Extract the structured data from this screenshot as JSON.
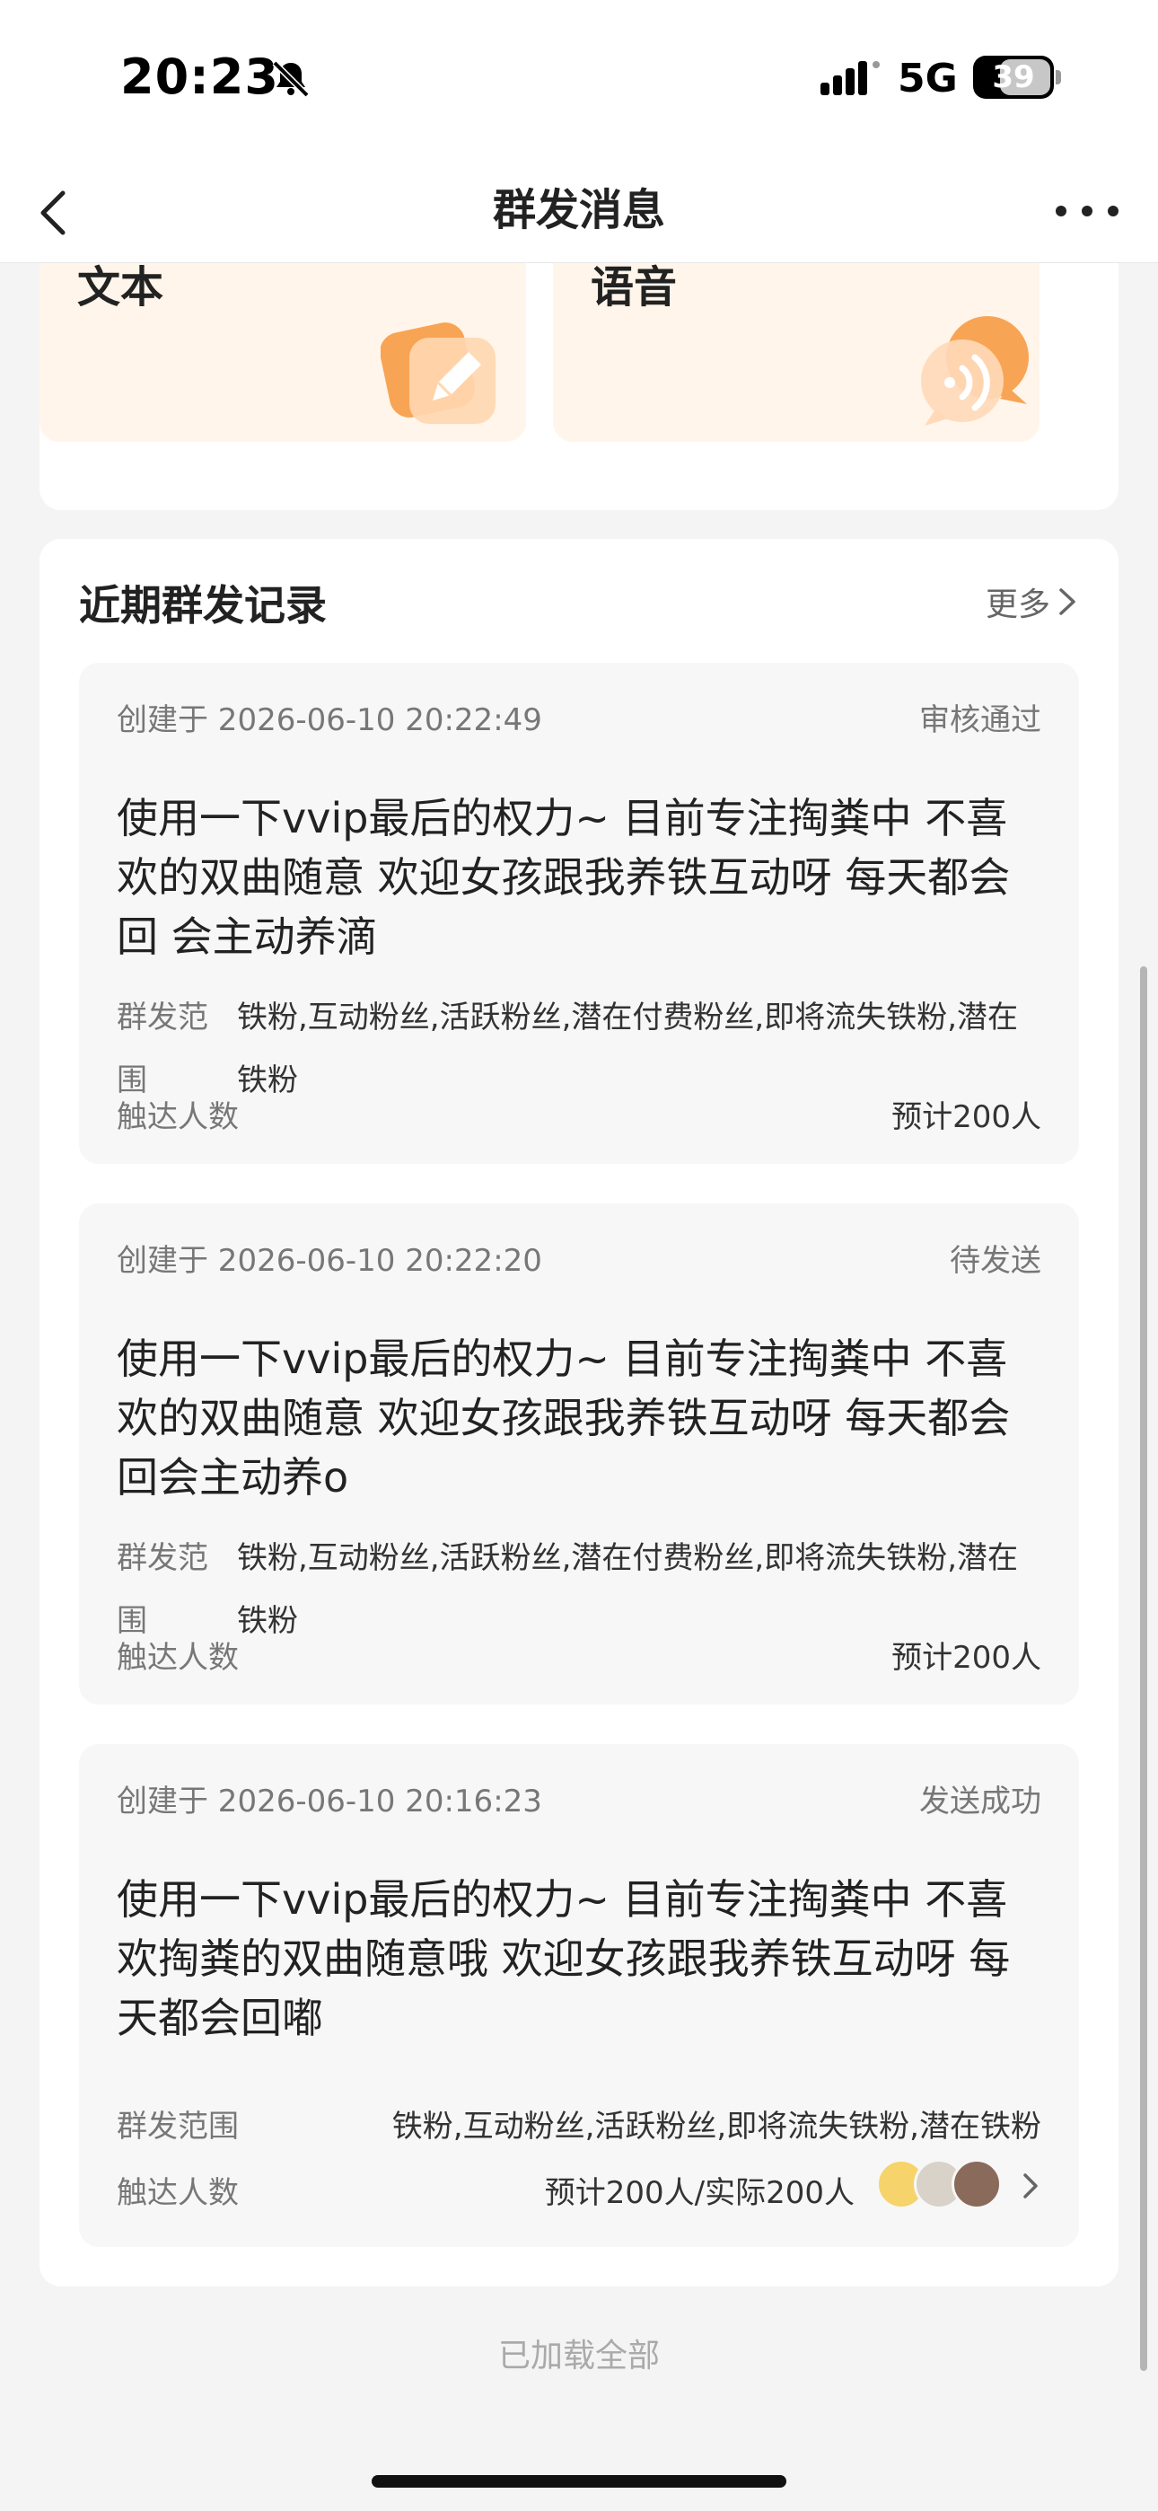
{
  "status_bar": {
    "time": "20:23",
    "network": "5G",
    "battery": "39"
  },
  "nav": {
    "title": "群发消息"
  },
  "message_types": [
    {
      "label": "文本",
      "icon": "pencil-icon"
    },
    {
      "label": "语音",
      "icon": "voice-bubble-icon"
    }
  ],
  "records_section": {
    "title": "近期群发记录",
    "more_label": "更多"
  },
  "records": [
    {
      "created": "创建于 2026-06-10 20:22:49",
      "status": "审核通过",
      "content": "使用一下vvip最后的权力~ 目前专注掏粪中 不喜欢的双曲随意 欢迎女孩跟我养铁互动呀 每天都会回 会主动养滴",
      "scope_label": "群发范围",
      "scope_value": "铁粉,互动粉丝,活跃粉丝,潜在付费粉丝,即将流失铁粉,潜在铁粉",
      "reach_label": "触达人数",
      "reach_value": "预计200人"
    },
    {
      "created": "创建于 2026-06-10 20:22:20",
      "status": "待发送",
      "content": "使用一下vvip最后的权力~ 目前专注掏粪中 不喜欢的双曲随意 欢迎女孩跟我养铁互动呀 每天都会回会主动养o",
      "scope_label": "群发范围",
      "scope_value": "铁粉,互动粉丝,活跃粉丝,潜在付费粉丝,即将流失铁粉,潜在铁粉",
      "reach_label": "触达人数",
      "reach_value": "预计200人"
    },
    {
      "created": "创建于 2026-06-10 20:16:23",
      "status": "发送成功",
      "content": "使用一下vvip最后的权力~ 目前专注掏粪中 不喜欢掏粪的双曲随意哦 欢迎女孩跟我养铁互动呀 每天都会回嘟",
      "scope_label": "群发范围",
      "scope_value": "铁粉,互动粉丝,活跃粉丝,即将流失铁粉,潜在铁粉",
      "reach_label": "触达人数",
      "reach_value": "预计200人/实际200人"
    }
  ],
  "footer": "已加载全部",
  "colors": {
    "tile_bg": "#fff5ea",
    "accent_orange": "#f7a04a",
    "page_bg": "#f4f4f4"
  }
}
